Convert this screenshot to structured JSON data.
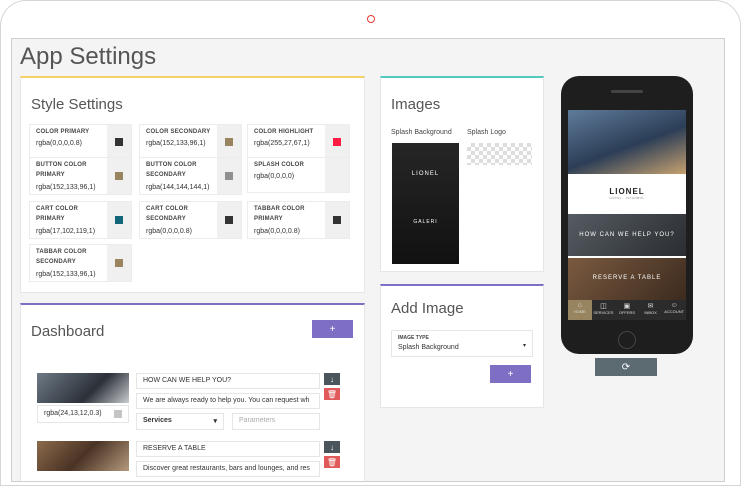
{
  "page_title": "App Settings",
  "style_settings": {
    "title": "Style Settings",
    "items": [
      {
        "label": "COLOR PRIMARY",
        "value": "rgba(0,0,0,0.8)",
        "color": "#333333"
      },
      {
        "label": "COLOR SECONDARY",
        "value": "rgba(152,133,96,1)",
        "color": "#988560"
      },
      {
        "label": "COLOR HIGHLIGHT",
        "value": "rgba(255,27,67,1)",
        "color": "#ff1b43"
      },
      {
        "label": "BUTTON COLOR PRIMARY",
        "value": "rgba(152,133,96,1)",
        "color": "#988560"
      },
      {
        "label": "BUTTON COLOR SECONDARY",
        "value": "rgba(144,144,144,1)",
        "color": "#909090"
      },
      {
        "label": "SPLASH COLOR",
        "value": "rgba(0,0,0,0)",
        "color": "transparent"
      },
      {
        "label": "CART COLOR PRIMARY",
        "value": "rgba(17,102,119,1)",
        "color": "#116677"
      },
      {
        "label": "CART COLOR SECONDARY",
        "value": "rgba(0,0,0,0.8)",
        "color": "#333333"
      },
      {
        "label": "TABBAR COLOR PRIMARY",
        "value": "rgba(0,0,0,0.8)",
        "color": "#333333"
      },
      {
        "label": "TABBAR COLOR SECONDARY",
        "value": "rgba(152,133,96,1)",
        "color": "#988560"
      }
    ]
  },
  "images": {
    "title": "Images",
    "splash_background_label": "Splash Background",
    "splash_logo_label": "Splash Logo",
    "splash_brand": "LIONEL",
    "splash_sub": "GALERI"
  },
  "add_image": {
    "title": "Add Image",
    "type_label": "IMAGE TYPE",
    "type_value": "Splash Background",
    "add_label": "+"
  },
  "dashboard": {
    "title": "Dashboard",
    "add_label": "+",
    "rows": [
      {
        "color": "rgba(24,13,12,0.3)",
        "title": "HOW CAN WE HELP YOU?",
        "desc": "We are always ready to help you. You can request wh",
        "service": "Services",
        "params_placeholder": "Parameters"
      },
      {
        "color": "",
        "title": "RESERVE A TABLE",
        "desc": "Discover great restaurants, bars and lounges, and res"
      }
    ]
  },
  "phone": {
    "brand": "LIONEL",
    "brand_sub": "HOTEL · ISTANBUL",
    "banner1": "HOW CAN WE HELP YOU?",
    "banner2": "RESERVE A TABLE",
    "tabs": [
      "HOME",
      "SERVICES",
      "OFFERS",
      "INBOX",
      "ACCOUNT"
    ]
  },
  "refresh_icon": "refresh-icon"
}
